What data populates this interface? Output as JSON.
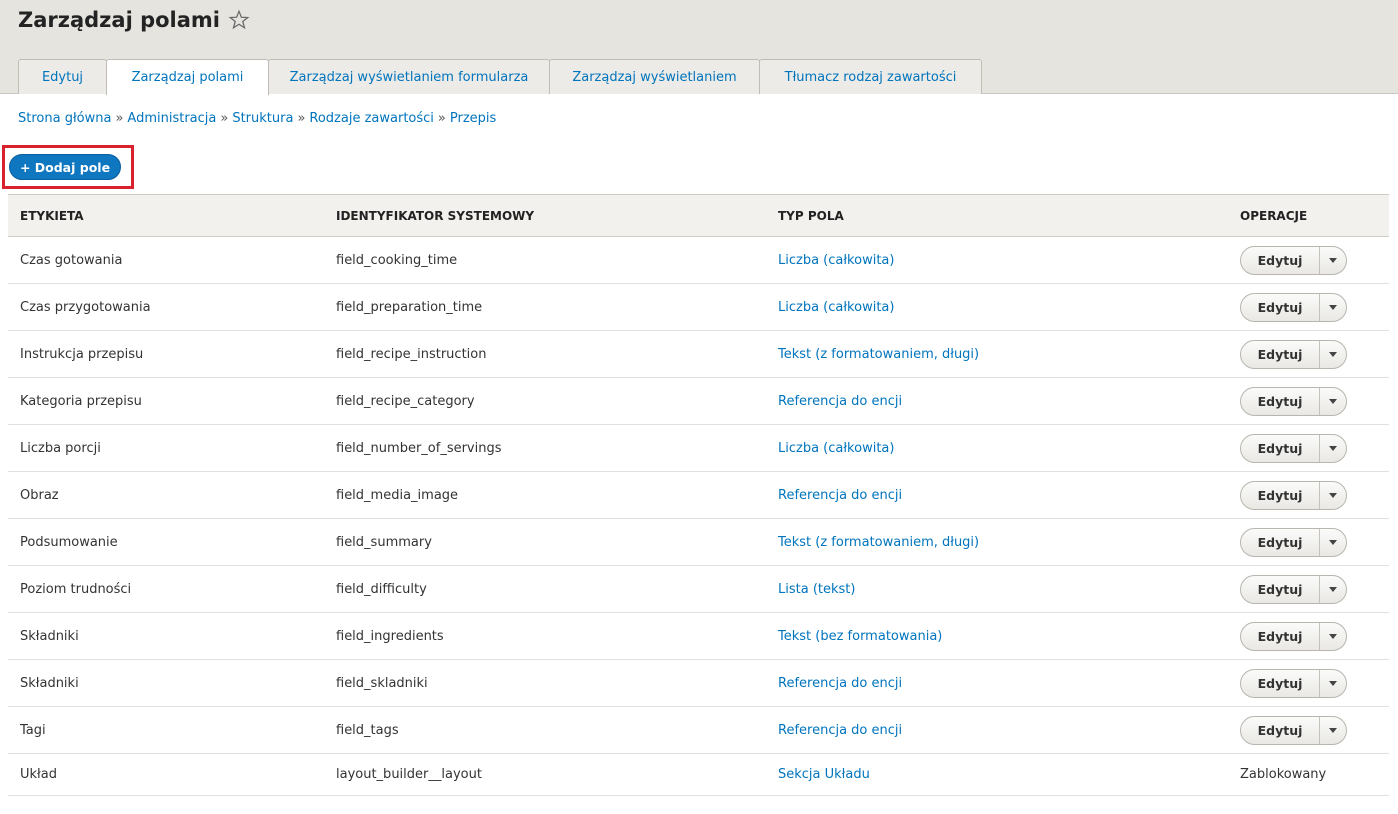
{
  "page": {
    "title": "Zarządzaj polami"
  },
  "tabs": [
    {
      "label": "Edytuj",
      "active": false
    },
    {
      "label": "Zarządzaj polami",
      "active": true
    },
    {
      "label": "Zarządzaj wyświetlaniem formularza",
      "active": false
    },
    {
      "label": "Zarządzaj wyświetlaniem",
      "active": false
    },
    {
      "label": "Tłumacz rodzaj zawartości",
      "active": false
    }
  ],
  "breadcrumb": [
    "Strona główna",
    "Administracja",
    "Struktura",
    "Rodzaje zawartości",
    "Przepis"
  ],
  "breadcrumb_separator": "»",
  "add_button": {
    "label": "+ Dodaj pole"
  },
  "table": {
    "headers": [
      "ETYKIETA",
      "IDENTYFIKATOR SYSTEMOWY",
      "TYP POLA",
      "OPERACJE"
    ],
    "rows": [
      {
        "label": "Czas gotowania",
        "id": "field_cooking_time",
        "type": "Liczba (całkowita)",
        "op": "Edytuj"
      },
      {
        "label": "Czas przygotowania",
        "id": "field_preparation_time",
        "type": "Liczba (całkowita)",
        "op": "Edytuj"
      },
      {
        "label": "Instrukcja przepisu",
        "id": "field_recipe_instruction",
        "type": "Tekst (z formatowaniem, długi)",
        "op": "Edytuj"
      },
      {
        "label": "Kategoria przepisu",
        "id": "field_recipe_category",
        "type": "Referencja do encji",
        "op": "Edytuj"
      },
      {
        "label": "Liczba porcji",
        "id": "field_number_of_servings",
        "type": "Liczba (całkowita)",
        "op": "Edytuj"
      },
      {
        "label": "Obraz",
        "id": "field_media_image",
        "type": "Referencja do encji",
        "op": "Edytuj"
      },
      {
        "label": "Podsumowanie",
        "id": "field_summary",
        "type": "Tekst (z formatowaniem, długi)",
        "op": "Edytuj"
      },
      {
        "label": "Poziom trudności",
        "id": "field_difficulty",
        "type": "Lista (tekst)",
        "op": "Edytuj"
      },
      {
        "label": "Składniki",
        "id": "field_ingredients",
        "type": "Tekst (bez formatowania)",
        "op": "Edytuj"
      },
      {
        "label": "Składniki",
        "id": "field_skladniki",
        "type": "Referencja do encji",
        "op": "Edytuj"
      },
      {
        "label": "Tagi",
        "id": "field_tags",
        "type": "Referencja do encji",
        "op": "Edytuj"
      },
      {
        "label": "Układ",
        "id": "layout_builder__layout",
        "type": "Sekcja Układu",
        "op": "Zablokowany",
        "locked": true
      }
    ]
  },
  "colors": {
    "link": "#0074bd",
    "primary_button": "#0f76c0",
    "highlight_border": "#d8232e"
  }
}
